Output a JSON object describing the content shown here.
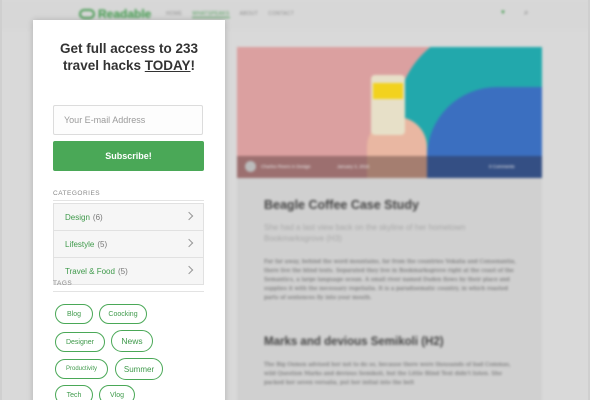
{
  "background_page": {
    "logo": "Readable",
    "nav": {
      "items": [
        "HOME",
        "WHATSPEAKS",
        "ABOUT",
        "CONTACT"
      ],
      "active_index": 1
    },
    "hero": {
      "author": "Charles Rivers in Design",
      "date": "January 3, 2016",
      "comments": "0 Comments"
    },
    "article": {
      "title": "Beagle Coffee Case Study",
      "subtitle": "She had a last view back on the skyline of her hometown Bookmarksgrove (H3)",
      "paragraph1": "Far far away, behind the word mountains, far from the countries Vokalia and Consonantia, there live the blind texts. Separated they live in Bookmarksgrove right at the coast of the Semantics, a large language ocean. A small river named Duden flows by their place and supplies it with the necessary regelialia. It is a paradisematic country, in which roasted parts of sentences fly into your mouth.",
      "heading2": "Marks and devious Semikoli (H2)",
      "paragraph2": "The Big Oxmox advised her not to do so, because there were thousands of bad Commas, wild Question Marks and devious Semikoli, but the Little Blind Text didn't listen. She packed her seven versalia, put her initial into the belt"
    }
  },
  "popup": {
    "title_line1": "Get full access to 233",
    "title_line2": "travel hacks",
    "title_emphasis": "TODAY",
    "title_end": "!",
    "email_placeholder": "Your E-mail Address",
    "subscribe_label": "Subscribe!",
    "categories_label": "CATEGORIES",
    "categories": [
      {
        "name": "Design",
        "count": "(6)"
      },
      {
        "name": "Lifestyle",
        "count": "(5)"
      },
      {
        "name": "Travel & Food",
        "count": "(5)"
      }
    ],
    "tags_label": "TAGS",
    "tags": [
      "Blog",
      "Coocking",
      "Designer",
      "News",
      "Productivity",
      "Summer",
      "Tech",
      "Vlog"
    ]
  },
  "colors": {
    "accent": "#4aa857",
    "accent_text": "#3f9a4b"
  }
}
